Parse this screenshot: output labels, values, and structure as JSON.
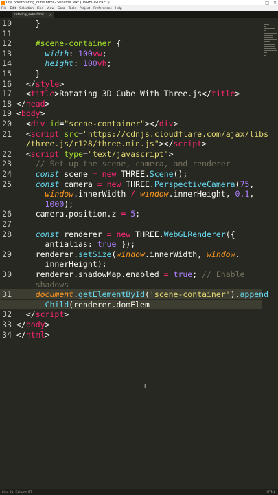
{
  "window": {
    "title": "D:\\Code\\rotating_cube.html - Sublime Text (UNREGISTERED)",
    "controls": [
      "–",
      "□",
      "✕"
    ]
  },
  "menu": [
    "File",
    "Edit",
    "Selection",
    "Find",
    "View",
    "Goto",
    "Tools",
    "Project",
    "Preferences",
    "Help"
  ],
  "tab": {
    "label": "rotating_cube.html",
    "close": "×"
  },
  "editor": {
    "current_line": "31",
    "lines": [
      {
        "n": "10",
        "tokens": [
          {
            "t": "    }",
            "c": ""
          }
        ]
      },
      {
        "n": "11",
        "tokens": []
      },
      {
        "n": "12",
        "tokens": [
          {
            "t": "    #scene-container",
            "c": "tok-sel"
          },
          {
            "t": " {",
            "c": ""
          }
        ]
      },
      {
        "n": "13",
        "tokens": [
          {
            "t": "      ",
            "c": ""
          },
          {
            "t": "width",
            "c": "tok-prop"
          },
          {
            "t": ": ",
            "c": ""
          },
          {
            "t": "100",
            "c": "tok-num"
          },
          {
            "t": "vw",
            "c": "tok-op"
          },
          {
            "t": ";",
            "c": ""
          }
        ]
      },
      {
        "n": "14",
        "tokens": [
          {
            "t": "      ",
            "c": ""
          },
          {
            "t": "height",
            "c": "tok-prop"
          },
          {
            "t": ": ",
            "c": ""
          },
          {
            "t": "100",
            "c": "tok-num"
          },
          {
            "t": "vh",
            "c": "tok-op"
          },
          {
            "t": ";",
            "c": ""
          }
        ]
      },
      {
        "n": "15",
        "tokens": [
          {
            "t": "    }",
            "c": ""
          }
        ]
      },
      {
        "n": "16",
        "tokens": [
          {
            "t": "  </",
            "c": ""
          },
          {
            "t": "style",
            "c": "tok-tag"
          },
          {
            "t": ">",
            "c": ""
          }
        ]
      },
      {
        "n": "17",
        "tokens": [
          {
            "t": "  <",
            "c": ""
          },
          {
            "t": "title",
            "c": "tok-tag"
          },
          {
            "t": ">Rotating 3D Cube With Three.js</",
            "c": ""
          },
          {
            "t": "title",
            "c": "tok-tag"
          },
          {
            "t": ">",
            "c": ""
          }
        ]
      },
      {
        "n": "18",
        "tokens": [
          {
            "t": "</",
            "c": ""
          },
          {
            "t": "head",
            "c": "tok-tag"
          },
          {
            "t": ">",
            "c": ""
          }
        ]
      },
      {
        "n": "19",
        "tokens": [
          {
            "t": "<",
            "c": ""
          },
          {
            "t": "body",
            "c": "tok-tag"
          },
          {
            "t": ">",
            "c": ""
          }
        ]
      },
      {
        "n": "20",
        "tokens": [
          {
            "t": "  <",
            "c": ""
          },
          {
            "t": "div",
            "c": "tok-tag"
          },
          {
            "t": " ",
            "c": ""
          },
          {
            "t": "id",
            "c": "tok-attr"
          },
          {
            "t": "=",
            "c": ""
          },
          {
            "t": "\"scene-container\"",
            "c": "tok-str"
          },
          {
            "t": "></",
            "c": ""
          },
          {
            "t": "div",
            "c": "tok-tag"
          },
          {
            "t": ">",
            "c": ""
          }
        ]
      },
      {
        "n": "21",
        "tokens": [
          {
            "t": "  <",
            "c": ""
          },
          {
            "t": "script",
            "c": "tok-tag"
          },
          {
            "t": " ",
            "c": ""
          },
          {
            "t": "src",
            "c": "tok-attr"
          },
          {
            "t": "=",
            "c": ""
          },
          {
            "t": "\"https://cdnjs.cloudflare.com/ajax/libs",
            "c": "tok-str"
          }
        ]
      },
      {
        "n": "",
        "tokens": [
          {
            "t": "  /three.js/r128/three.min.js\"",
            "c": "tok-str"
          },
          {
            "t": "></",
            "c": ""
          },
          {
            "t": "script",
            "c": "tok-tag"
          },
          {
            "t": ">",
            "c": ""
          }
        ]
      },
      {
        "n": "22",
        "tokens": [
          {
            "t": "  <",
            "c": ""
          },
          {
            "t": "script",
            "c": "tok-tag"
          },
          {
            "t": " ",
            "c": ""
          },
          {
            "t": "type",
            "c": "tok-attr"
          },
          {
            "t": "=",
            "c": ""
          },
          {
            "t": "\"text/javascript\"",
            "c": "tok-str"
          },
          {
            "t": ">",
            "c": ""
          }
        ]
      },
      {
        "n": "23",
        "tokens": [
          {
            "t": "    // Set up the scene, camera, and renderer",
            "c": "tok-cm"
          }
        ]
      },
      {
        "n": "24",
        "tokens": [
          {
            "t": "    ",
            "c": ""
          },
          {
            "t": "const",
            "c": "tok-kw"
          },
          {
            "t": " scene ",
            "c": ""
          },
          {
            "t": "=",
            "c": "tok-op"
          },
          {
            "t": " ",
            "c": ""
          },
          {
            "t": "new",
            "c": "tok-op"
          },
          {
            "t": " THREE.",
            "c": ""
          },
          {
            "t": "Scene",
            "c": "tok-fn"
          },
          {
            "t": "();",
            "c": ""
          }
        ]
      },
      {
        "n": "25",
        "tokens": [
          {
            "t": "    ",
            "c": ""
          },
          {
            "t": "const",
            "c": "tok-kw"
          },
          {
            "t": " camera ",
            "c": ""
          },
          {
            "t": "=",
            "c": "tok-op"
          },
          {
            "t": " ",
            "c": ""
          },
          {
            "t": "new",
            "c": "tok-op"
          },
          {
            "t": " THREE.",
            "c": ""
          },
          {
            "t": "PerspectiveCamera",
            "c": "tok-fn"
          },
          {
            "t": "(",
            "c": ""
          },
          {
            "t": "75",
            "c": "tok-num"
          },
          {
            "t": ",",
            "c": ""
          }
        ]
      },
      {
        "n": "",
        "tokens": [
          {
            "t": "      ",
            "c": ""
          },
          {
            "t": "window",
            "c": "tok-var"
          },
          {
            "t": ".innerWidth ",
            "c": ""
          },
          {
            "t": "/",
            "c": "tok-op"
          },
          {
            "t": " ",
            "c": ""
          },
          {
            "t": "window",
            "c": "tok-var"
          },
          {
            "t": ".innerHeight, ",
            "c": ""
          },
          {
            "t": "0.1",
            "c": "tok-num"
          },
          {
            "t": ",",
            "c": ""
          }
        ]
      },
      {
        "n": "",
        "tokens": [
          {
            "t": "      ",
            "c": ""
          },
          {
            "t": "1000",
            "c": "tok-num"
          },
          {
            "t": ");",
            "c": ""
          }
        ]
      },
      {
        "n": "26",
        "tokens": [
          {
            "t": "    camera.position.z ",
            "c": ""
          },
          {
            "t": "=",
            "c": "tok-op"
          },
          {
            "t": " ",
            "c": ""
          },
          {
            "t": "5",
            "c": "tok-num"
          },
          {
            "t": ";",
            "c": ""
          }
        ]
      },
      {
        "n": "27",
        "tokens": []
      },
      {
        "n": "28",
        "tokens": [
          {
            "t": "    ",
            "c": ""
          },
          {
            "t": "const",
            "c": "tok-kw"
          },
          {
            "t": " renderer ",
            "c": ""
          },
          {
            "t": "=",
            "c": "tok-op"
          },
          {
            "t": " ",
            "c": ""
          },
          {
            "t": "new",
            "c": "tok-op"
          },
          {
            "t": " THREE.",
            "c": ""
          },
          {
            "t": "WebGLRenderer",
            "c": "tok-fn"
          },
          {
            "t": "({",
            "c": ""
          }
        ]
      },
      {
        "n": "",
        "tokens": [
          {
            "t": "      antialias: ",
            "c": ""
          },
          {
            "t": "true",
            "c": "tok-bool"
          },
          {
            "t": " });",
            "c": ""
          }
        ]
      },
      {
        "n": "29",
        "tokens": [
          {
            "t": "    renderer.",
            "c": ""
          },
          {
            "t": "setSize",
            "c": "tok-fn"
          },
          {
            "t": "(",
            "c": ""
          },
          {
            "t": "window",
            "c": "tok-var"
          },
          {
            "t": ".innerWidth, ",
            "c": ""
          },
          {
            "t": "window",
            "c": "tok-var"
          },
          {
            "t": ".",
            "c": ""
          }
        ]
      },
      {
        "n": "",
        "tokens": [
          {
            "t": "      innerHeight);",
            "c": ""
          }
        ]
      },
      {
        "n": "30",
        "tokens": [
          {
            "t": "    renderer.shadowMap.enabled ",
            "c": ""
          },
          {
            "t": "=",
            "c": "tok-op"
          },
          {
            "t": " ",
            "c": ""
          },
          {
            "t": "true",
            "c": "tok-bool"
          },
          {
            "t": "; ",
            "c": ""
          },
          {
            "t": "// Enable",
            "c": "tok-cm"
          }
        ]
      },
      {
        "n": "",
        "tokens": [
          {
            "t": "    shadows",
            "c": "tok-cm"
          }
        ]
      },
      {
        "n": "31",
        "tokens": [
          {
            "t": "    ",
            "c": ""
          },
          {
            "t": "document",
            "c": "tok-var"
          },
          {
            "t": ".",
            "c": ""
          },
          {
            "t": "getElementById",
            "c": "tok-fn"
          },
          {
            "t": "(",
            "c": ""
          },
          {
            "t": "'scene-container'",
            "c": "tok-str"
          },
          {
            "t": ").",
            "c": ""
          },
          {
            "t": "append",
            "c": "tok-fn"
          }
        ]
      },
      {
        "n": "",
        "tokens": [
          {
            "t": "      ",
            "c": ""
          },
          {
            "t": "Child",
            "c": "tok-fn"
          },
          {
            "t": "(renderer.domElem",
            "c": ""
          }
        ],
        "cursor": true
      },
      {
        "n": "32",
        "tokens": [
          {
            "t": "  </",
            "c": ""
          },
          {
            "t": "script",
            "c": "tok-tag"
          },
          {
            "t": ">",
            "c": ""
          }
        ]
      },
      {
        "n": "33",
        "tokens": [
          {
            "t": "</",
            "c": ""
          },
          {
            "t": "body",
            "c": "tok-tag"
          },
          {
            "t": ">",
            "c": ""
          }
        ]
      },
      {
        "n": "34",
        "tokens": [
          {
            "t": "</",
            "c": ""
          },
          {
            "t": "html",
            "c": "tok-tag"
          },
          {
            "t": ">",
            "c": ""
          }
        ]
      }
    ]
  },
  "status": {
    "left": "Line 31, Column 57",
    "right": "HTML"
  }
}
